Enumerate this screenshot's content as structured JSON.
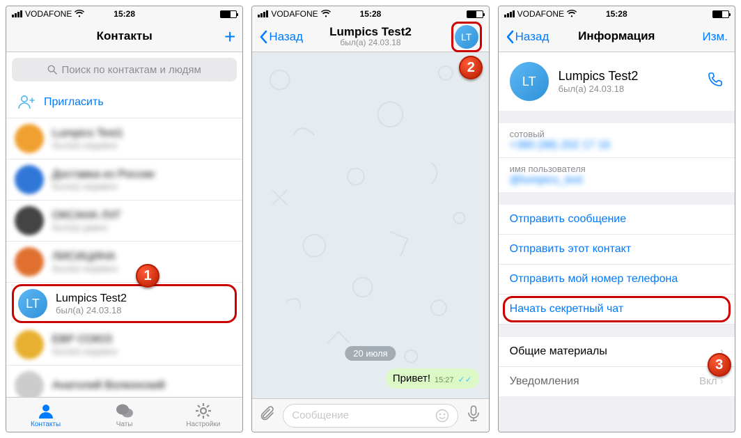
{
  "status": {
    "carrier": "VODAFONE",
    "time": "15:28"
  },
  "screen1": {
    "title": "Контакты",
    "search_placeholder": "Поиск по контактам и людям",
    "invite": "Пригласить",
    "contacts": [
      {
        "name": "Lumpics Test1",
        "sub": "был(а) недавно",
        "avatar_bg": "#f0a030",
        "blur": true
      },
      {
        "name": "Доставка из России",
        "sub": "был(а) недавно",
        "avatar_bg": "#3077d8",
        "blur": true
      },
      {
        "name": "ОКСАНА ЛУГ",
        "sub": "был(а) давно",
        "avatar_bg": "#444",
        "blur": true
      },
      {
        "name": "ЛИСИЦИНА",
        "sub": "был(а) недавно",
        "avatar_bg": "#e07030",
        "blur": true
      },
      {
        "name": "Lumpics Test2",
        "sub": "был(а) 24.03.18",
        "avatar_initials": "LT",
        "blur": false,
        "highlight": true
      },
      {
        "name": "ЕВР СОЮЗ",
        "sub": "был(а) недавно",
        "avatar_bg": "#e8b030",
        "blur": true
      },
      {
        "name": "Анатолий Волконский",
        "sub": "",
        "avatar_bg": "#ccc",
        "blur": true
      }
    ],
    "tabs": {
      "contacts": "Контакты",
      "chats": "Чаты",
      "settings": "Настройки"
    }
  },
  "screen2": {
    "back": "Назад",
    "title": "Lumpics Test2",
    "subtitle": "был(а) 24.03.18",
    "avatar_initials": "LT",
    "date": "20 июля",
    "message": "Привет!",
    "message_time": "15:27",
    "input_placeholder": "Сообщение"
  },
  "screen3": {
    "back": "Назад",
    "title": "Информация",
    "edit": "Изм.",
    "name": "Lumpics Test2",
    "sub": "был(а) 24.03.18",
    "avatar_initials": "LT",
    "phone_label": "сотовый",
    "phone_value": "+380 (98) 202 17 16",
    "user_label": "имя пользователя",
    "user_value": "@lumpics_test",
    "actions": {
      "send_msg": "Отправить сообщение",
      "send_contact": "Отправить этот контакт",
      "send_number": "Отправить мой номер телефона",
      "secret": "Начать секретный чат"
    },
    "shared": "Общие материалы",
    "notif": "Уведомления",
    "notif_val": "Вкл"
  },
  "badges": {
    "b1": "1",
    "b2": "2",
    "b3": "3"
  }
}
